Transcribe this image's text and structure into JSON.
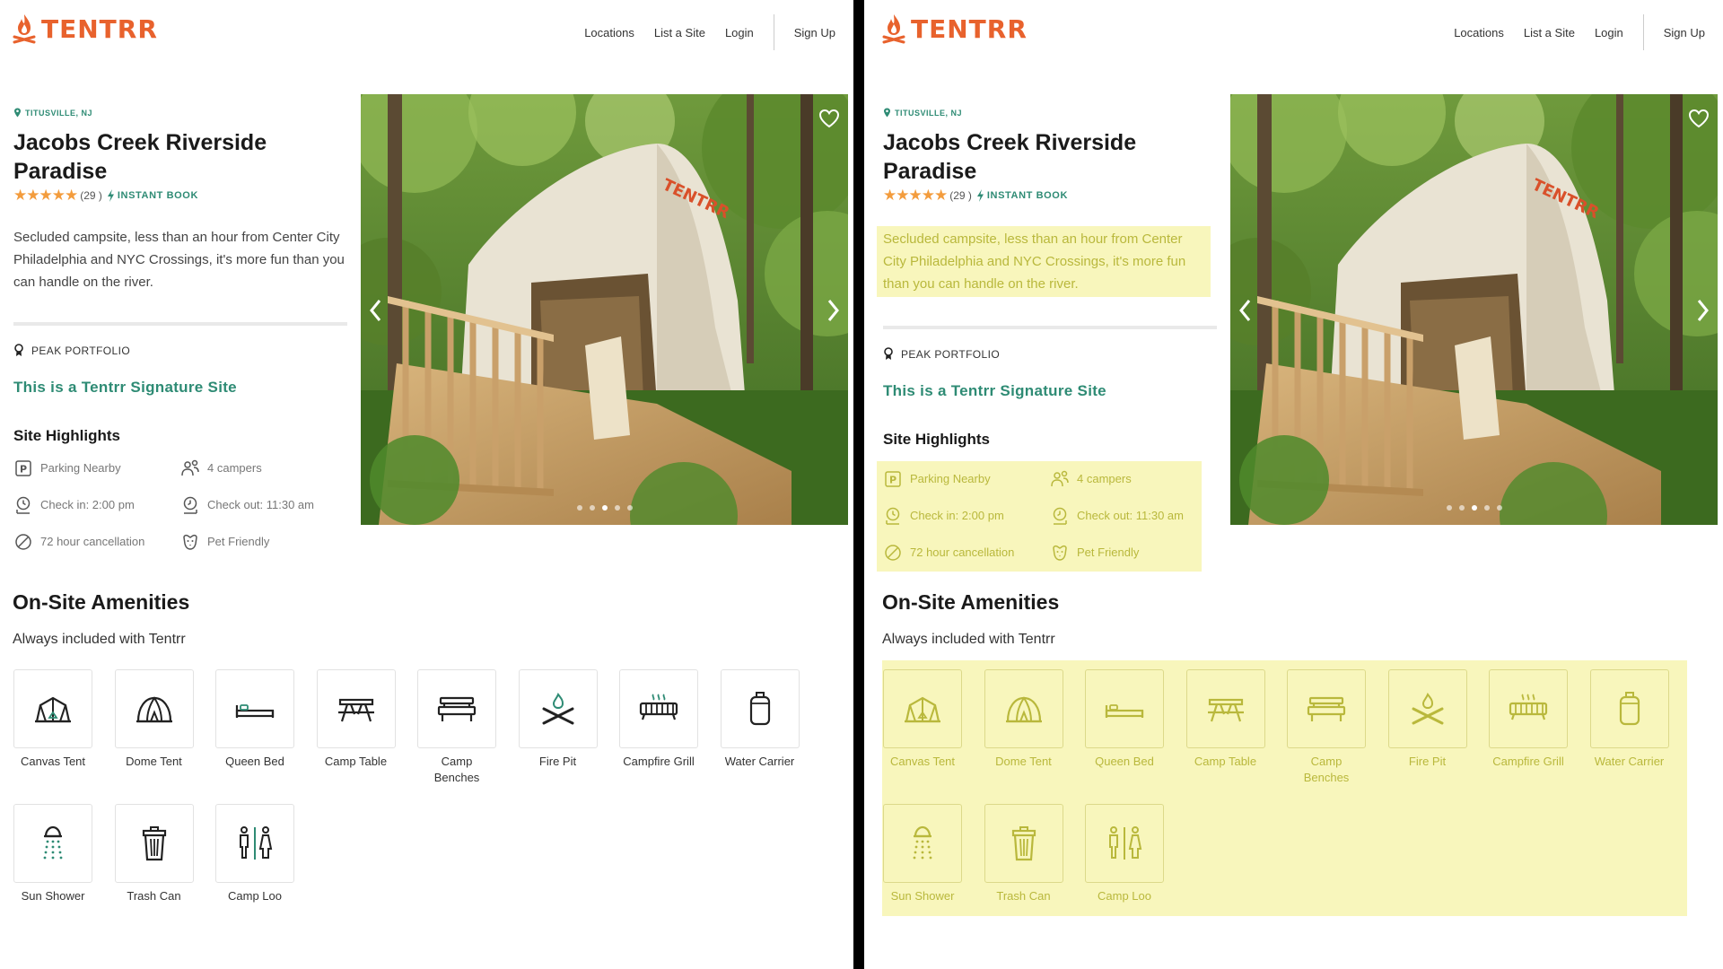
{
  "brand": {
    "name": "TENTRR",
    "color": "#e8622d"
  },
  "nav": {
    "locations": "Locations",
    "list_site": "List a Site",
    "login": "Login",
    "signup": "Sign Up"
  },
  "site": {
    "location": "TITUSVILLE, NJ",
    "title": "Jacobs Creek Riverside Paradise",
    "stars": "★★★★★",
    "rating_count": "(29 )",
    "instant_book": "INSTANT BOOK",
    "description": "Secluded campsite, less than an hour from Center City Philadelphia and NYC Crossings, it's more fun than you can handle on the river.",
    "portfolio": "PEAK PORTFOLIO",
    "signature": "This is a Tentrr Signature Site"
  },
  "highlights": {
    "heading": "Site Highlights",
    "items": [
      {
        "label": "Parking Nearby",
        "icon": "parking-icon"
      },
      {
        "label": "4 campers",
        "icon": "campers-icon"
      },
      {
        "label": "Check in: 2:00 pm",
        "icon": "check-in-icon"
      },
      {
        "label": "Check out: 11:30 am",
        "icon": "check-out-icon"
      },
      {
        "label": "72 hour cancellation",
        "icon": "cancellation-icon"
      },
      {
        "label": "Pet Friendly",
        "icon": "pet-icon"
      }
    ]
  },
  "amenities": {
    "heading": "On-Site Amenities",
    "subheading": "Always included with Tentrr",
    "items": [
      {
        "label": "Canvas Tent",
        "icon": "canvas-tent-icon"
      },
      {
        "label": "Dome Tent",
        "icon": "dome-tent-icon"
      },
      {
        "label": "Queen Bed",
        "icon": "queen-bed-icon"
      },
      {
        "label": "Camp Table",
        "icon": "camp-table-icon"
      },
      {
        "label": "Camp Benches",
        "icon": "camp-benches-icon"
      },
      {
        "label": "Fire Pit",
        "icon": "fire-pit-icon"
      },
      {
        "label": "Campfire Grill",
        "icon": "campfire-grill-icon"
      },
      {
        "label": "Water Carrier",
        "icon": "water-carrier-icon"
      },
      {
        "label": "Sun Shower",
        "icon": "sun-shower-icon"
      },
      {
        "label": "Trash Can",
        "icon": "trash-can-icon"
      },
      {
        "label": "Camp Loo",
        "icon": "camp-loo-icon"
      }
    ]
  },
  "photo": {
    "tent_brand": "TENTRR",
    "slide_count": 5,
    "active_slide": 2
  },
  "colors": {
    "accent": "#2e8b74",
    "stars": "#f39c3d",
    "highlight": "#f8f6bc",
    "highlight_text": "#b9b83c"
  }
}
